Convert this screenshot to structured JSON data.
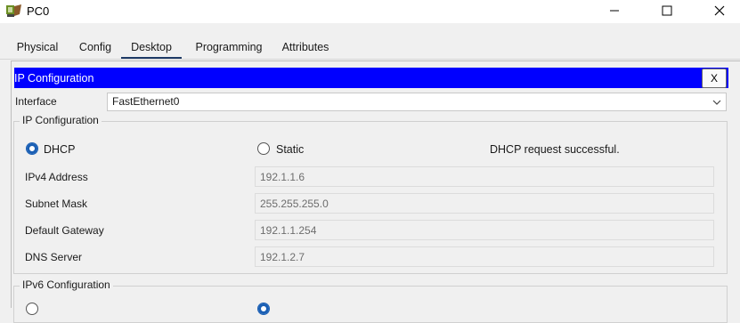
{
  "window": {
    "title": "PC0"
  },
  "tabs": [
    {
      "label": "Physical"
    },
    {
      "label": "Config"
    },
    {
      "label": "Desktop"
    },
    {
      "label": "Programming"
    },
    {
      "label": "Attributes"
    }
  ],
  "active_tab": "Desktop",
  "panel": {
    "title": "IP Configuration",
    "close_label": "X",
    "interface_label": "Interface",
    "interface_value": "FastEthernet0",
    "ipv4": {
      "group_title": "IP Configuration",
      "mode_options": [
        {
          "label": "DHCP",
          "selected": true
        },
        {
          "label": "Static",
          "selected": false
        }
      ],
      "status": "DHCP request successful.",
      "fields": [
        {
          "label": "IPv4 Address",
          "value": "192.1.1.6"
        },
        {
          "label": "Subnet Mask",
          "value": "255.255.255.0"
        },
        {
          "label": "Default Gateway",
          "value": "192.1.1.254"
        },
        {
          "label": "DNS Server",
          "value": "192.1.2.7"
        }
      ]
    },
    "ipv6": {
      "group_title": "IPv6 Configuration"
    }
  },
  "colors": {
    "header_blue": "#0000ff",
    "radio_blue": "#1a5fb4"
  },
  "icons": {
    "app": "packet-tracer-pc-icon",
    "minimize": "minimize-icon",
    "maximize": "maximize-icon",
    "close": "close-icon",
    "dropdown": "chevron-down-icon"
  }
}
